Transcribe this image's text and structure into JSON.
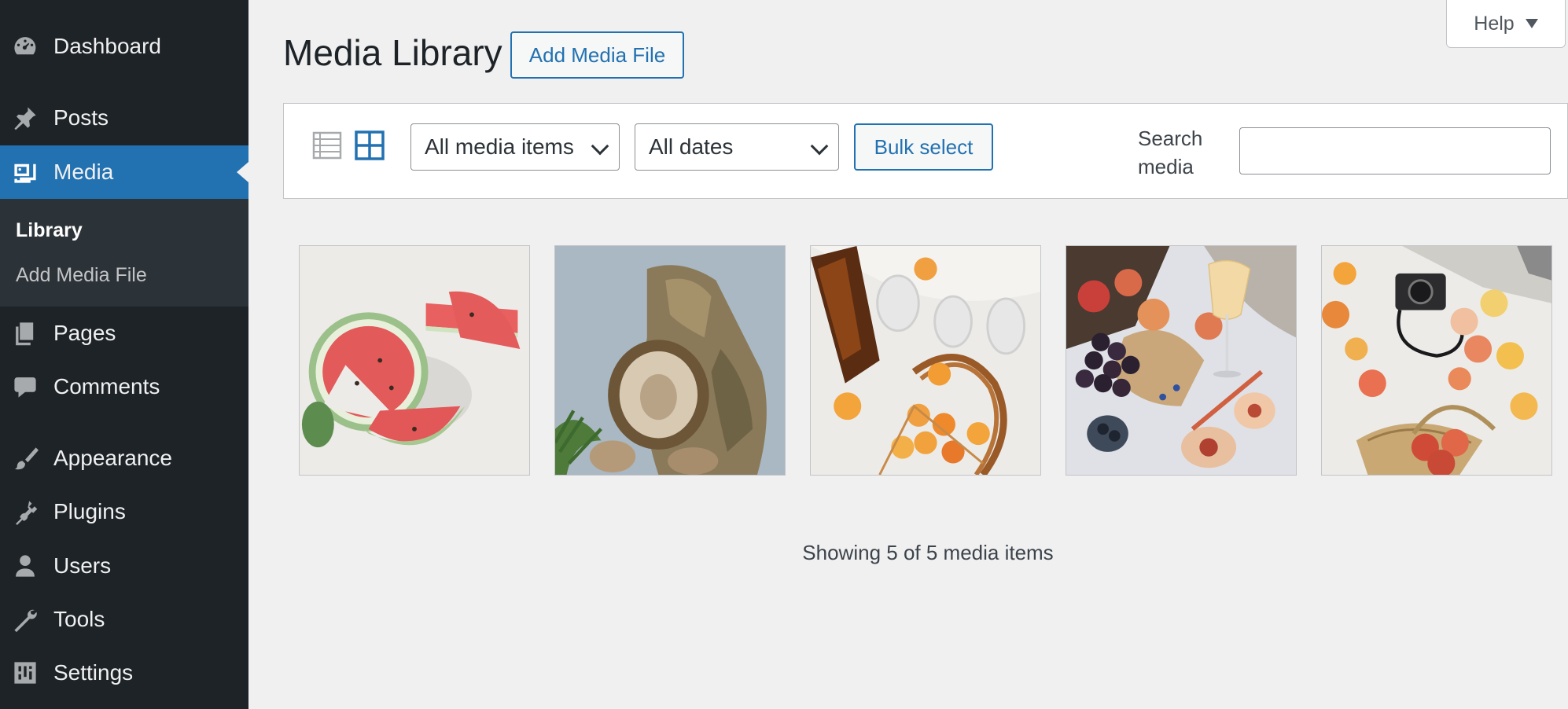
{
  "sidebar": {
    "items": [
      {
        "label": "Dashboard",
        "icon": "dashboard-icon"
      },
      {
        "label": "Posts",
        "icon": "pushpin-icon"
      },
      {
        "label": "Media",
        "icon": "media-icon",
        "active": true
      },
      {
        "label": "Pages",
        "icon": "pages-icon"
      },
      {
        "label": "Comments",
        "icon": "comment-icon"
      },
      {
        "label": "Appearance",
        "icon": "paintbrush-icon"
      },
      {
        "label": "Plugins",
        "icon": "plugin-icon"
      },
      {
        "label": "Users",
        "icon": "user-icon"
      },
      {
        "label": "Tools",
        "icon": "wrench-icon"
      },
      {
        "label": "Settings",
        "icon": "settings-sliders-icon"
      }
    ],
    "submenu": [
      {
        "label": "Library",
        "current": true
      },
      {
        "label": "Add Media File"
      }
    ]
  },
  "header": {
    "title": "Media Library",
    "add_button": "Add Media File",
    "help": "Help"
  },
  "toolbar": {
    "view_modes": [
      "list-view-icon",
      "grid-view-icon"
    ],
    "active_view": "grid",
    "media_filter": "All media items",
    "date_filter": "All dates",
    "bulk_select": "Bulk select",
    "search_label": "Search media",
    "search_value": ""
  },
  "media": {
    "items": [
      {
        "subject": "watermelon"
      },
      {
        "subject": "mushroom"
      },
      {
        "subject": "peaches-picnic"
      },
      {
        "subject": "fruit-wine"
      },
      {
        "subject": "camera-peaches"
      }
    ],
    "status": "Showing 5 of 5 media items"
  },
  "colors": {
    "sidebar_bg": "#1d2327",
    "submenu_bg": "#2c3338",
    "accent": "#2271b1",
    "page_bg": "#f0f0f1"
  }
}
